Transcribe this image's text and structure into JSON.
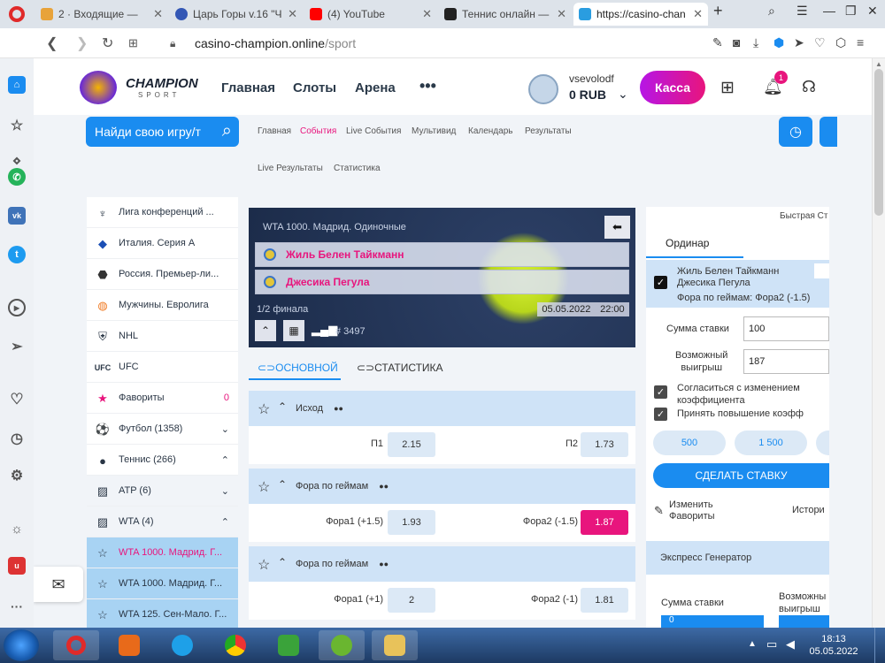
{
  "browser": {
    "tabs": [
      {
        "title": "2 · Входящие — ",
        "color": "#e8a33a"
      },
      {
        "title": "Царь Горы v.16 \"Ч",
        "color": "#3357b5"
      },
      {
        "title": "(4) YouTube",
        "color": "#ff0000"
      },
      {
        "title": "Теннис онлайн — ",
        "color": "#222222"
      },
      {
        "title": "https://casino-chan",
        "color": "#2a9de0"
      }
    ],
    "new_tab": "+",
    "url_host": "casino-champion.online",
    "url_path": "/sport"
  },
  "site": {
    "logo_main": "CHAMPION",
    "logo_sub": "SPORT",
    "nav": [
      "Главная",
      "Слоты",
      "Арена",
      "•••"
    ],
    "username": "vsevolodf",
    "balance": "0 RUB",
    "kassa": "Касса",
    "notif_count": "1",
    "search_placeholder": "Найди свою игру/т",
    "sublinks_row1": [
      "Главная",
      "События",
      "Live События",
      "Мультивид",
      "Календарь",
      "Результаты"
    ],
    "sublinks_row2": [
      "Live Результаты",
      "Статистика"
    ]
  },
  "left_menu": [
    {
      "label": "Лига конференций ...",
      "icon": "trophy-icon",
      "right": ""
    },
    {
      "label": "Италия. Серия А",
      "icon": "serie-a-icon",
      "right": ""
    },
    {
      "label": "Россия. Премьер-ли...",
      "icon": "rpl-icon",
      "right": ""
    },
    {
      "label": "Мужчины. Евролига",
      "icon": "basketball-icon",
      "right": ""
    },
    {
      "label": "NHL",
      "icon": "nhl-icon",
      "right": ""
    },
    {
      "label": "UFC",
      "icon": "ufc-icon",
      "right": ""
    },
    {
      "label": "Фавориты",
      "icon": "star-icon",
      "right": "0"
    },
    {
      "label": "Футбол (1358)",
      "icon": "football-icon",
      "right": "⌄"
    },
    {
      "label": "Теннис (266)",
      "icon": "tennis-icon",
      "right": "⌃"
    },
    {
      "label": "ATP (6)",
      "icon": "world-map-icon",
      "right": "⌄"
    },
    {
      "label": "WTA (4)",
      "icon": "world-map-icon",
      "right": "⌃"
    },
    {
      "label": "WTA 1000. Мадрид. Г...",
      "icon": "star-outline-icon",
      "right": ""
    },
    {
      "label": "WTA 1000. Мадрид. Г...",
      "icon": "star-outline-icon",
      "right": ""
    },
    {
      "label": "WTA 125. Сен-Мало. Г...",
      "icon": "star-outline-icon",
      "right": ""
    }
  ],
  "match": {
    "tournament": "WTA 1000. Мадрид. Одиночные",
    "team1": "Жиль Белен Тайкманн",
    "team2": "Джесика Пегула",
    "stage": "1/2 финала",
    "date": "05.05.2022",
    "time": "22:00",
    "event_id": "# 3497",
    "tab_main": "ОСНОВНОЙ",
    "tab_stats": "СТАТИСТИКА"
  },
  "markets": [
    {
      "name": "Исход",
      "l_label": "П1",
      "l_odd": "2.15",
      "r_label": "П2",
      "r_odd": "1.73"
    },
    {
      "name": "Фора по геймам",
      "l_label": "Фора1 (+1.5)",
      "l_odd": "1.93",
      "r_label": "Фора2 (-1.5)",
      "r_odd": "1.87"
    },
    {
      "name": "Фора по геймам",
      "l_label": "Фора1 (+1)",
      "l_odd": "2",
      "r_label": "Фора2 (-1)",
      "r_odd": "1.81"
    }
  ],
  "betslip": {
    "quick": "Быстрая Ст",
    "tab_single": "Ординар",
    "sel_line1": "Жиль Белен Тайкманн",
    "sel_line2": "Джесика Пегула",
    "sel_market": "Фора по геймам: Фора2 (-1.5)",
    "stake_label": "Сумма ставки",
    "stake_value": "100",
    "win_label1": "Возможный",
    "win_label2": "выигрыш",
    "win_value": "187",
    "agree_line1": "Согласиться с изменением",
    "agree_line2": "коэффициента",
    "accept": "Принять повышение коэфф",
    "amounts": [
      "500",
      "1 500"
    ],
    "place": "СДЕЛАТЬ СТАВКУ",
    "fav_line1": "Изменить",
    "fav_line2": "Фавориты",
    "history": "Истори",
    "express": "Экспресс Генератор",
    "ex_stake": "Сумма ставки",
    "ex_win1": "Возможны",
    "ex_win2": "выигрыш",
    "ex_value": "0"
  },
  "taskbar": {
    "time": "18:13",
    "date": "05.05.2022"
  }
}
